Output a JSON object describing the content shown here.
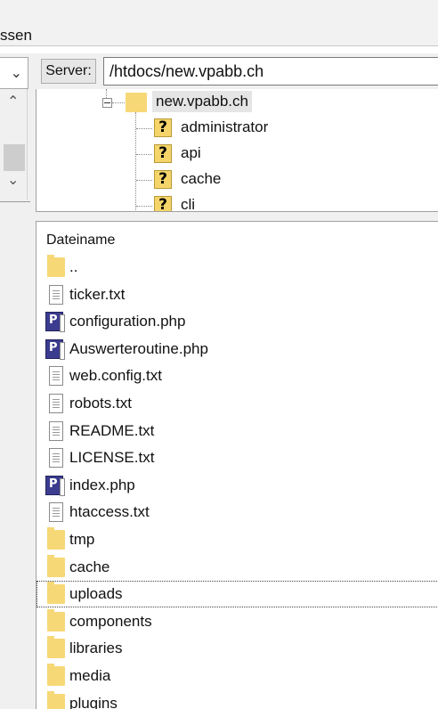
{
  "menu": {
    "fragment_text": "ssen"
  },
  "local": {
    "combo_chevron": "chevron-down-icon"
  },
  "remote": {
    "server_label": "Server:",
    "server_path": "/htdocs/new.vpabb.ch",
    "tree": {
      "root": "new.vpabb.ch",
      "children": [
        "administrator",
        "api",
        "cache",
        "cli"
      ]
    }
  },
  "filelist": {
    "column_header": "Dateiname",
    "files": [
      {
        "name": "..",
        "icon": "folder"
      },
      {
        "name": "ticker.txt",
        "icon": "file"
      },
      {
        "name": "configuration.php",
        "icon": "php"
      },
      {
        "name": "Auswerteroutine.php",
        "icon": "php"
      },
      {
        "name": "web.config.txt",
        "icon": "file"
      },
      {
        "name": "robots.txt",
        "icon": "file"
      },
      {
        "name": "README.txt",
        "icon": "file"
      },
      {
        "name": "LICENSE.txt",
        "icon": "file"
      },
      {
        "name": "index.php",
        "icon": "php"
      },
      {
        "name": "htaccess.txt",
        "icon": "file"
      },
      {
        "name": "tmp",
        "icon": "folder"
      },
      {
        "name": "cache",
        "icon": "folder"
      },
      {
        "name": "uploads",
        "icon": "folder"
      },
      {
        "name": "components",
        "icon": "folder"
      },
      {
        "name": "libraries",
        "icon": "folder"
      },
      {
        "name": "media",
        "icon": "folder"
      },
      {
        "name": "plugins",
        "icon": "folder"
      }
    ]
  },
  "colors": {
    "folder": "#f7d877",
    "php_badge": "#3b3b8f",
    "selection": "#e5e5e5"
  }
}
